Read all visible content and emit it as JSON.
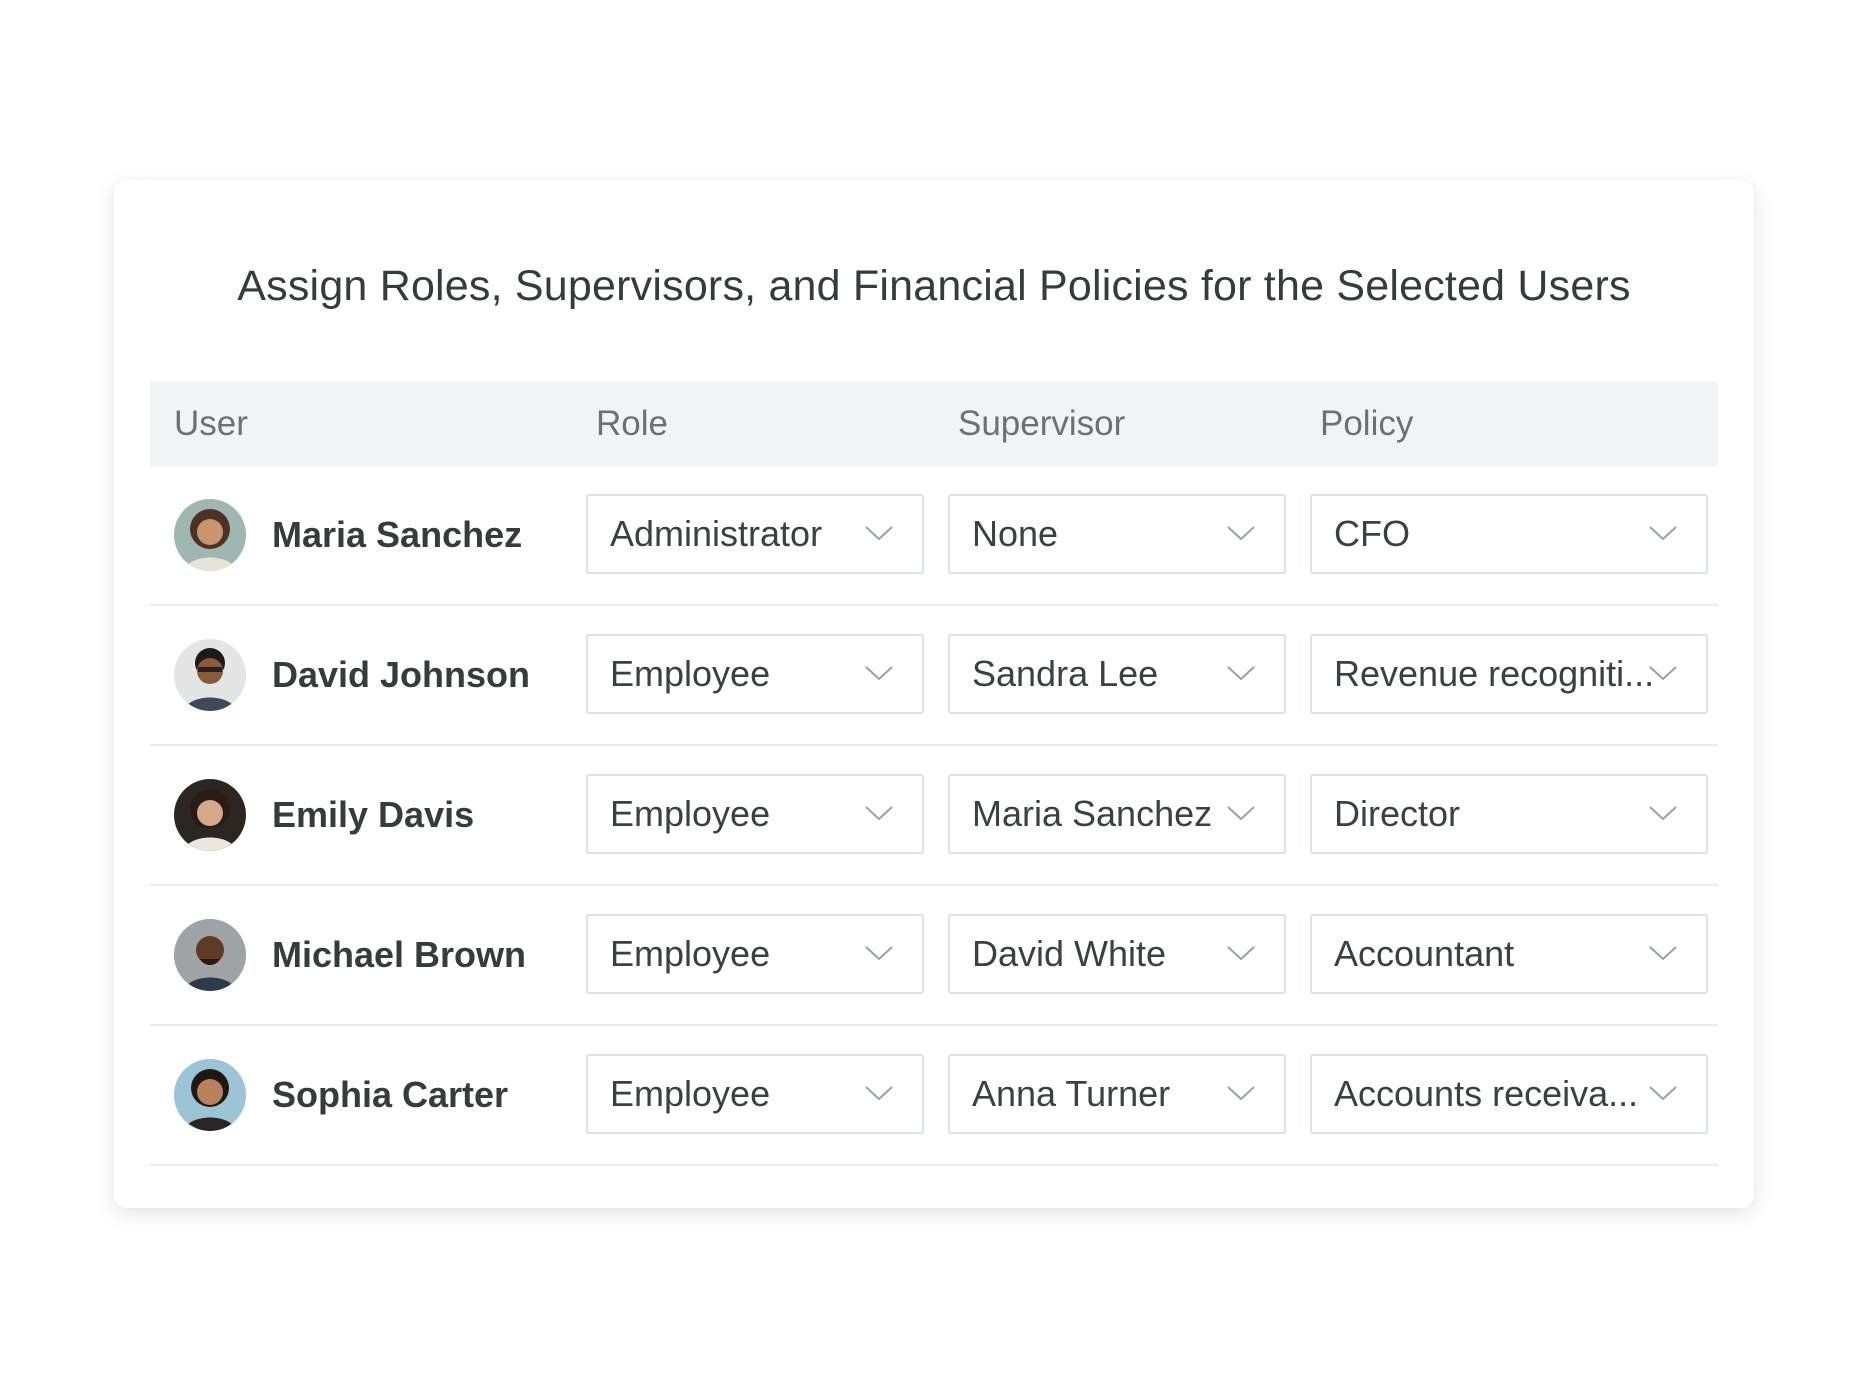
{
  "dialog": {
    "title": "Assign Roles, Supervisors, and Financial Policies for the Selected Users"
  },
  "table": {
    "headers": {
      "user": "User",
      "role": "Role",
      "supervisor": "Supervisor",
      "policy": "Policy"
    },
    "rows": [
      {
        "user": "Maria Sanchez",
        "avatar_icon": "user-avatar-photo",
        "role": "Administrator",
        "supervisor": "None",
        "policy": "CFO"
      },
      {
        "user": "David Johnson",
        "avatar_icon": "user-avatar-photo",
        "role": "Employee",
        "supervisor": "Sandra Lee",
        "policy": "Revenue recogniti..."
      },
      {
        "user": "Emily Davis",
        "avatar_icon": "user-avatar-photo",
        "role": "Employee",
        "supervisor": "Maria Sanchez",
        "policy": "Director"
      },
      {
        "user": "Michael Brown",
        "avatar_icon": "user-avatar-photo",
        "role": "Employee",
        "supervisor": "David White",
        "policy": "Accountant"
      },
      {
        "user": "Sophia Carter",
        "avatar_icon": "user-avatar-photo",
        "role": "Employee",
        "supervisor": "Anna Turner",
        "policy": "Accounts receiva..."
      }
    ]
  },
  "icons": {
    "dropdown": "chevron-down-icon"
  },
  "colors": {
    "header_bg": "#f0f4f4",
    "text_primary": "#363b3b",
    "text_muted": "#6a7272",
    "border": "#dde3e3"
  }
}
